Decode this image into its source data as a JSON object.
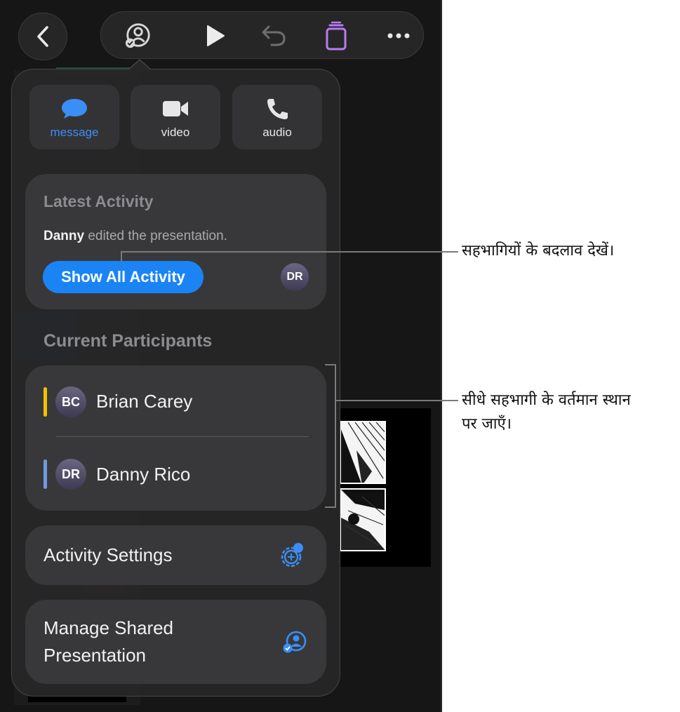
{
  "toolbar": {
    "back_icon": "chevron-left-icon",
    "collab_icon": "person-checkmark-icon",
    "play_icon": "play-icon",
    "undo_icon": "undo-arrow-icon",
    "slides_icon": "stacked-slides-icon",
    "more_icon": "ellipsis-icon",
    "accent_color": "#b77cf4"
  },
  "contact_buttons": [
    {
      "label": "message",
      "icon": "message-bubble-icon",
      "active": true
    },
    {
      "label": "video",
      "icon": "video-camera-icon",
      "active": false
    },
    {
      "label": "audio",
      "icon": "phone-icon",
      "active": false
    }
  ],
  "latest_activity": {
    "title": "Latest Activity",
    "actor": "Danny",
    "action_text": " edited the presentation.",
    "button_label": "Show All Activity",
    "avatar_initials": "DR"
  },
  "participants": {
    "title": "Current Participants",
    "items": [
      {
        "initials": "BC",
        "name": "Brian Carey",
        "bar_color": "#f2c200"
      },
      {
        "initials": "DR",
        "name": "Danny Rico",
        "bar_color": "#6f9be0"
      }
    ]
  },
  "activity_settings": {
    "label": "Activity Settings",
    "icon": "gear-person-icon"
  },
  "manage_shared": {
    "label_line1": "Manage Shared",
    "label_line2": "Presentation",
    "icon": "person-checkmark-icon"
  },
  "callouts": {
    "activity": "सहभागियों के बदलाव देखें।",
    "participants_line1": "सीधे सहभागी के वर्तमान स्थान",
    "participants_line2": "पर जाएँ।"
  },
  "colors": {
    "accent_blue": "#1a84f5",
    "label_blue": "#3a8ef6"
  }
}
